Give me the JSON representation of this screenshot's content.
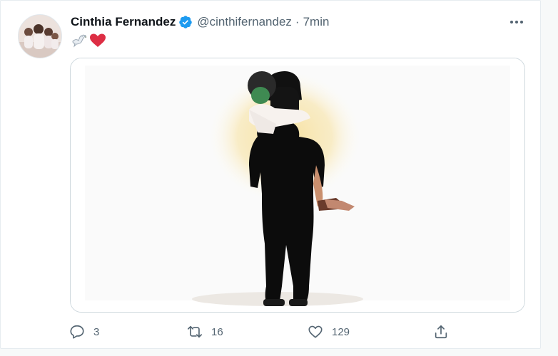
{
  "tweet": {
    "author_name": "Cinthia Fernandez",
    "handle": "@cinthifernandez",
    "separator": "·",
    "time": "7min",
    "text_emoji": [
      "dove-emoji",
      "red-heart-emoji"
    ],
    "verified": true
  },
  "actions": {
    "reply_count": "3",
    "retweet_count": "16",
    "like_count": "129"
  },
  "colors": {
    "verified_blue": "#1d9bf0",
    "secondary_text": "#536471",
    "heart_red": "#dd2e44"
  }
}
